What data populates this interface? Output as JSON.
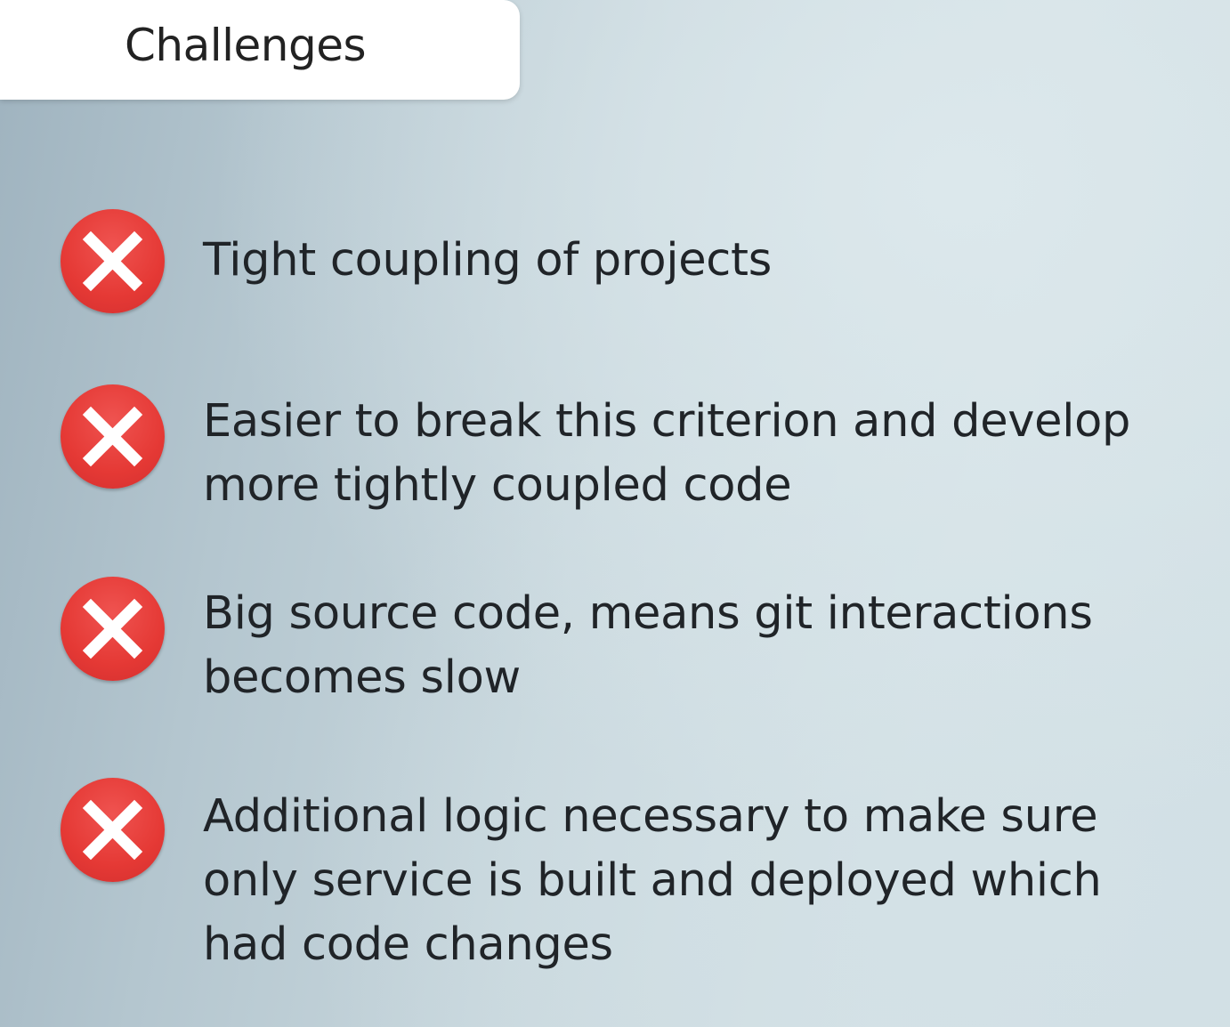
{
  "title": "Challenges",
  "colors": {
    "icon_red": "#e53935",
    "icon_cross": "#ffffff",
    "text": "#202428"
  },
  "bullets": [
    {
      "icon": "x-circle-icon",
      "text": "Tight coupling of projects"
    },
    {
      "icon": "x-circle-icon",
      "text": "Easier to break this criterion and develop more tightly coupled code"
    },
    {
      "icon": "x-circle-icon",
      "text": "Big source code, means git interactions becomes slow"
    },
    {
      "icon": "x-circle-icon",
      "text": "Additional logic necessary to make sure only service is built and deployed which had code changes"
    }
  ]
}
